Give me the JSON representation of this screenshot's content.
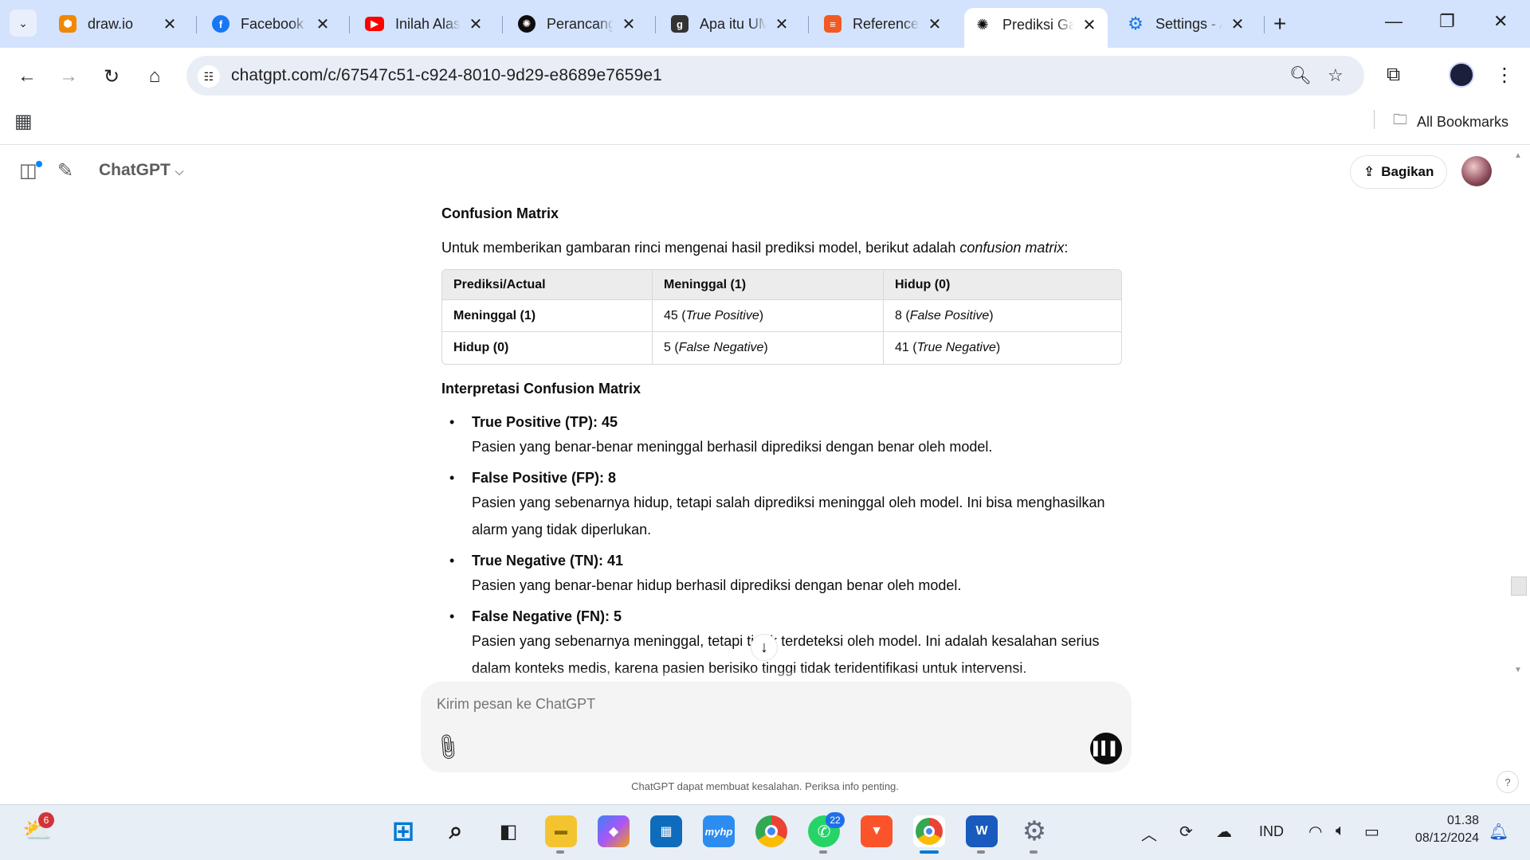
{
  "browser": {
    "tabs": [
      {
        "label": "draw.io",
        "icon": "drawio-icon",
        "color": "#f08705"
      },
      {
        "label": "Facebook",
        "icon": "facebook-icon",
        "color": "#1877f2"
      },
      {
        "label": "Inilah Alasan",
        "icon": "youtube-icon",
        "color": "#ff0000"
      },
      {
        "label": "Perancangan",
        "icon": "chatgpt-icon",
        "color": "#0d0d0d"
      },
      {
        "label": "Apa itu UML",
        "icon": "g-icon",
        "color": "#333333"
      },
      {
        "label": "References",
        "icon": "reference-icon",
        "color": "#f15a24"
      },
      {
        "label": "Prediksi Gagal",
        "icon": "chatgpt-icon",
        "color": "#0d0d0d"
      },
      {
        "label": "Settings - Apps",
        "icon": "gear-icon",
        "color": "#1a73e8"
      }
    ],
    "url": "chatgpt.com/c/67547c51-c924-8010-9d29-e8689e7659e1",
    "bookmarks_label": "All Bookmarks"
  },
  "chat": {
    "model_name": "ChatGPT",
    "share_label": "Bagikan",
    "section_title": "Confusion Matrix",
    "intro_text": "Untuk memberikan gambaran rinci mengenai hasil prediksi model, berikut adalah ",
    "intro_em": "confusion matrix",
    "intro_end": ":",
    "table": {
      "headers": [
        "Prediksi/Actual",
        "Meninggal (1)",
        "Hidup (0)"
      ],
      "rows": [
        {
          "label": "Meninggal (1)",
          "c1_num": "45",
          "c1_em": "True Positive",
          "c2_num": "8",
          "c2_em": "False Positive"
        },
        {
          "label": "Hidup (0)",
          "c1_num": "5",
          "c1_em": "False Negative",
          "c2_num": "41",
          "c2_em": "True Negative"
        }
      ]
    },
    "interp_title": "Interpretasi Confusion Matrix",
    "items": [
      {
        "title": "True Positive (TP): 45",
        "desc": "Pasien yang benar-benar meninggal berhasil diprediksi dengan benar oleh model."
      },
      {
        "title": "False Positive (FP): 8",
        "desc": "Pasien yang sebenarnya hidup, tetapi salah diprediksi meninggal oleh model. Ini bisa menghasilkan alarm yang tidak diperlukan."
      },
      {
        "title": "True Negative (TN): 41",
        "desc": "Pasien yang benar-benar hidup berhasil diprediksi dengan benar oleh model."
      },
      {
        "title": "False Negative (FN): 5",
        "desc": "Pasien yang sebenarnya meninggal, tetapi tidak terdeteksi oleh model. Ini adalah kesalahan serius dalam konteks medis, karena pasien berisiko tinggi tidak teridentifikasi untuk intervensi."
      }
    ],
    "composer_placeholder": "Kirim pesan ke ChatGPT",
    "disclaimer": "ChatGPT dapat membuat kesalahan. Periksa info penting.",
    "help_label": "?"
  },
  "taskbar": {
    "weather_badge": "6",
    "whatsapp_badge": "22",
    "language": "IND",
    "time": "01.38",
    "date": "08/12/2024"
  }
}
